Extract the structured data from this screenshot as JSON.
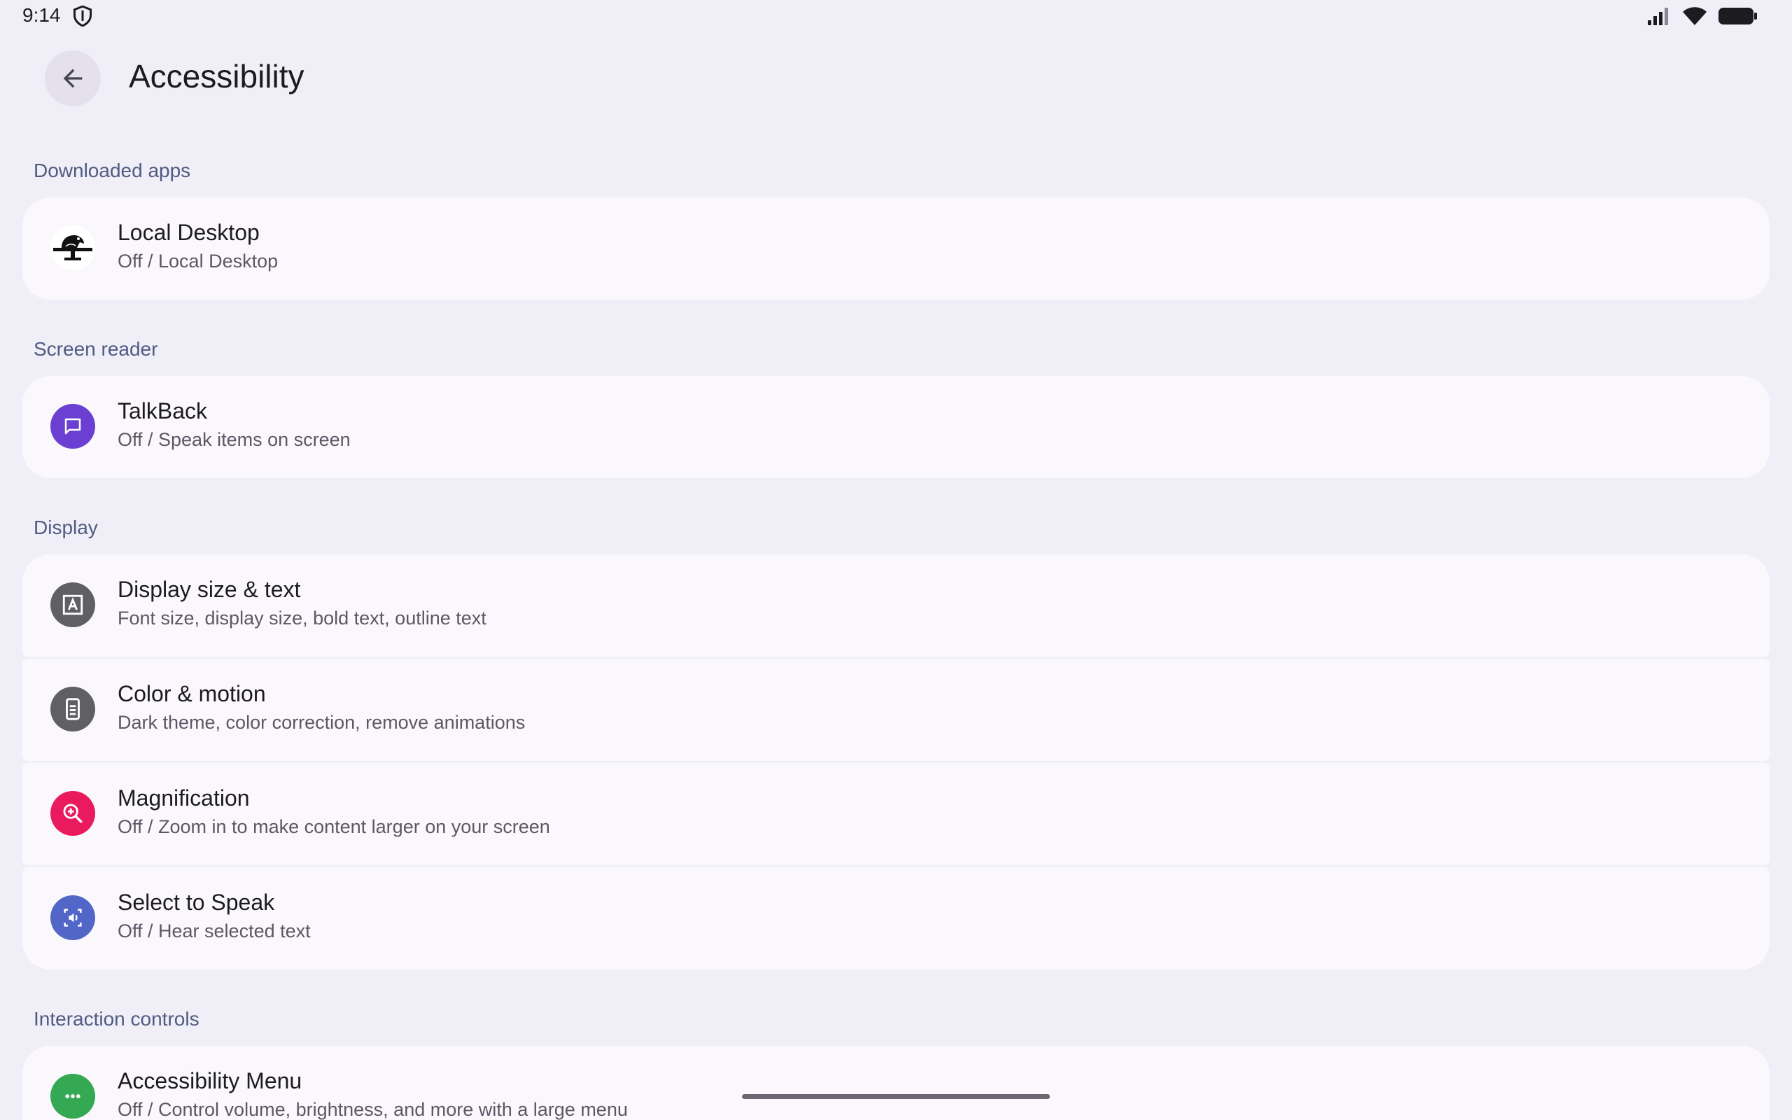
{
  "status_bar": {
    "time": "9:14"
  },
  "app_bar": {
    "title": "Accessibility",
    "back_icon": "arrow-back-icon"
  },
  "sections": [
    {
      "header": "Downloaded apps",
      "items": [
        {
          "title": "Local Desktop",
          "subtitle": "Off / Local Desktop",
          "icon": "local-desktop-app-icon"
        }
      ]
    },
    {
      "header": "Screen reader",
      "items": [
        {
          "title": "TalkBack",
          "subtitle": "Off / Speak items on screen",
          "icon": "talkback-icon",
          "color": "#6a3fd1"
        }
      ]
    },
    {
      "header": "Display",
      "items": [
        {
          "title": "Display size & text",
          "subtitle": "Font size, display size, bold text, outline text",
          "icon": "text-format-icon",
          "color": "#5f5f64"
        },
        {
          "title": "Color & motion",
          "subtitle": "Dark theme, color correction, remove animations",
          "icon": "phone-color-icon",
          "color": "#5f5f64"
        },
        {
          "title": "Magnification",
          "subtitle": "Off / Zoom in to make content larger on your screen",
          "icon": "zoom-in-icon",
          "color": "#ea1a5e"
        },
        {
          "title": "Select to Speak",
          "subtitle": "Off / Hear selected text",
          "icon": "select-to-speak-icon",
          "color": "#5166c6"
        }
      ]
    },
    {
      "header": "Interaction controls",
      "items": [
        {
          "title": "Accessibility Menu",
          "subtitle": "Off / Control volume, brightness, and more with a large menu",
          "icon": "more-horizontal-icon",
          "color": "#34a853"
        }
      ]
    }
  ]
}
